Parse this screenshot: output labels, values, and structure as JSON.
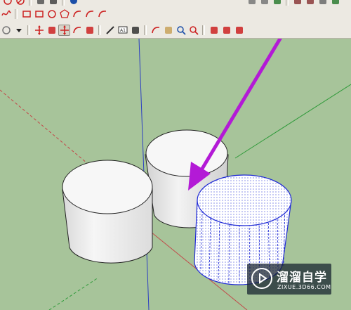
{
  "toolbar": {
    "row1_left": [
      {
        "icon": "circle-tool-icon",
        "color": "#cc2222"
      },
      {
        "icon": "no-entry-icon",
        "color": "#cc2222"
      },
      {
        "icon": "arrow-icon",
        "color": "#555555"
      },
      {
        "icon": "paint-icon",
        "color": "#444444"
      },
      {
        "icon": "info-icon",
        "color": "#1b4fa8"
      }
    ],
    "row1_right": [
      {
        "icon": "view-icon-1",
        "color": "#777777"
      },
      {
        "icon": "view-icon-2",
        "color": "#777777"
      },
      {
        "icon": "view-icon-3",
        "color": "#2e7d32"
      },
      {
        "icon": "component-icon-1",
        "color": "#8b3a3a"
      },
      {
        "icon": "component-icon-2",
        "color": "#8b3a3a"
      },
      {
        "icon": "component-icon-3",
        "color": "#6a6a6a"
      },
      {
        "icon": "component-icon-4",
        "color": "#2e7d32"
      }
    ],
    "row2": [
      {
        "icon": "freehand-icon",
        "color": "#cc2222"
      },
      {
        "icon": "rectangle-icon",
        "color": "#cc2222"
      },
      {
        "icon": "rotated-rectangle-icon",
        "color": "#cc2222"
      },
      {
        "icon": "circle-icon",
        "color": "#cc2222"
      },
      {
        "icon": "polygon-icon",
        "color": "#cc2222"
      },
      {
        "icon": "arc-icon",
        "color": "#cc2222"
      },
      {
        "icon": "two-point-arc-icon",
        "color": "#cc2222"
      },
      {
        "icon": "pie-icon",
        "color": "#cc2222"
      }
    ],
    "row3": [
      {
        "icon": "eraser-icon",
        "color": "#777777"
      },
      {
        "icon": "dropdown-arrow-icon",
        "color": "#222222"
      },
      {
        "icon": "move-icon",
        "color": "#cc2222"
      },
      {
        "icon": "push-pull-icon",
        "color": "#cc2222"
      },
      {
        "icon": "move-tool-icon",
        "color": "#cc2222",
        "pressed": true
      },
      {
        "icon": "rotate-icon",
        "color": "#cc2222"
      },
      {
        "icon": "scale-icon",
        "color": "#cc2222"
      },
      {
        "icon": "tape-measure-icon",
        "color": "#333333"
      },
      {
        "icon": "text-icon",
        "color": "#333333"
      },
      {
        "icon": "axes-icon",
        "color": "#333333"
      },
      {
        "icon": "orbit-icon",
        "color": "#cc2222"
      },
      {
        "icon": "pan-icon",
        "color": "#c8a25a"
      },
      {
        "icon": "zoom-icon",
        "color": "#1b4fa8"
      },
      {
        "icon": "zoom-extents-icon",
        "color": "#cc2222"
      },
      {
        "icon": "warehouse-icon",
        "color": "#cc2222"
      },
      {
        "icon": "extension-warehouse-icon",
        "color": "#cc2222"
      },
      {
        "icon": "share-model-icon",
        "color": "#cc2222"
      }
    ]
  },
  "viewport": {
    "background": "#a7c49a",
    "axis_colors": {
      "red": "#c24a4a",
      "green": "#2f9a3a",
      "blue": "#2c3ec2"
    },
    "selected_edge_color": "#1f2ad6",
    "annotation_arrow_color": "#b31ad6"
  },
  "watermark": {
    "title": "溜溜自学",
    "subtitle": "ZIXUE.3D66.COM"
  }
}
